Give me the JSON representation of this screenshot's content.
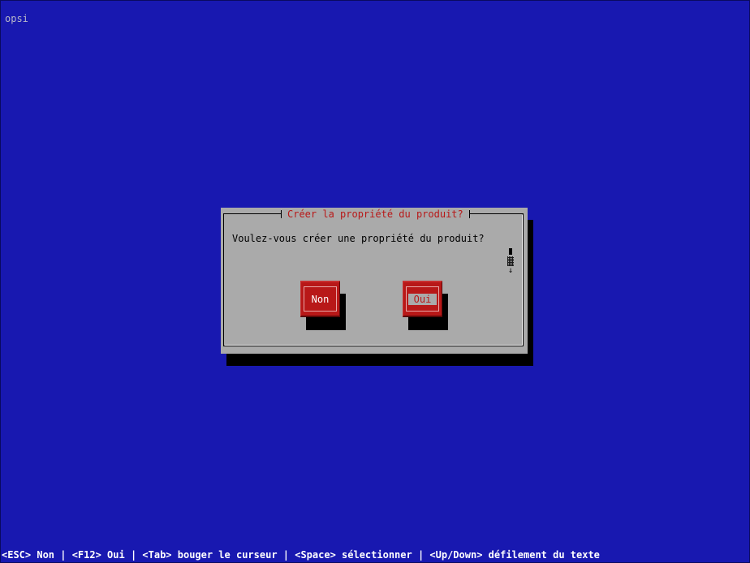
{
  "app": {
    "title": "opsi"
  },
  "dialog": {
    "title": "Créer la propriété du produit?",
    "message": "Voulez-vous créer une propriété du produit?",
    "scroll_arrow": "↓",
    "buttons": {
      "no_label": "Non",
      "yes_label": "Oui",
      "focused": "yes"
    }
  },
  "status_bar": {
    "text": "<ESC> Non | <F12> Oui | <Tab> bouger le curseur | <Space> sélectionner | <Up/Down> défilement du texte"
  },
  "colors": {
    "background": "#1818b0",
    "dialog": "#aaaaaa",
    "accent": "#b81818",
    "shadow": "#000000"
  }
}
